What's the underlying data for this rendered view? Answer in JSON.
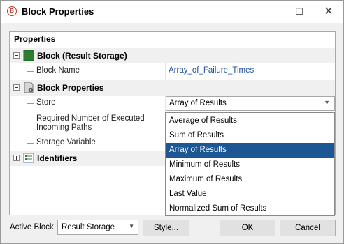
{
  "window": {
    "title": "Block Properties",
    "icon_letter": "B"
  },
  "grid": {
    "header": "Properties",
    "block_result_storage": {
      "label": "Block (Result Storage)",
      "block_name_label": "Block Name",
      "block_name_value": "Array_of_Failure_Times"
    },
    "block_properties": {
      "label": "Block Properties",
      "store_label": "Store",
      "store_value": "Array of Results",
      "required_paths_label_line1": "Required Number of Executed",
      "required_paths_label_line2": "Incoming Paths",
      "storage_variable_label": "Storage Variable"
    },
    "identifiers": {
      "label": "Identifiers"
    }
  },
  "dropdown": {
    "options": [
      "Average of Results",
      "Sum of Results",
      "Array of Results",
      "Minimum of Results",
      "Maximum of Results",
      "Last Value",
      "Normalized Sum of Results"
    ],
    "selected_index": 2
  },
  "footer": {
    "active_block_label": "Active Block",
    "active_block_value": "Result Storage",
    "style_button": "Style...",
    "ok_button": "OK",
    "cancel_button": "Cancel"
  },
  "colors": {
    "selection": "#1c5693",
    "link": "#1f4e9c",
    "block_icon": "#2e7d32"
  }
}
